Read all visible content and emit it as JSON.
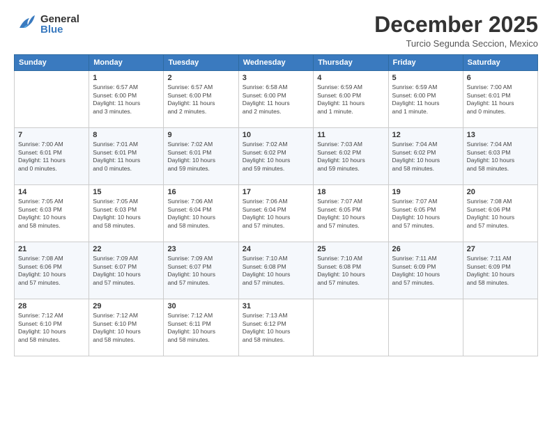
{
  "header": {
    "logo_general": "General",
    "logo_blue": "Blue",
    "month_title": "December 2025",
    "location": "Turcio Segunda Seccion, Mexico"
  },
  "calendar": {
    "days_of_week": [
      "Sunday",
      "Monday",
      "Tuesday",
      "Wednesday",
      "Thursday",
      "Friday",
      "Saturday"
    ],
    "weeks": [
      [
        {
          "day": "",
          "info": ""
        },
        {
          "day": "1",
          "info": "Sunrise: 6:57 AM\nSunset: 6:00 PM\nDaylight: 11 hours\nand 3 minutes."
        },
        {
          "day": "2",
          "info": "Sunrise: 6:57 AM\nSunset: 6:00 PM\nDaylight: 11 hours\nand 2 minutes."
        },
        {
          "day": "3",
          "info": "Sunrise: 6:58 AM\nSunset: 6:00 PM\nDaylight: 11 hours\nand 2 minutes."
        },
        {
          "day": "4",
          "info": "Sunrise: 6:59 AM\nSunset: 6:00 PM\nDaylight: 11 hours\nand 1 minute."
        },
        {
          "day": "5",
          "info": "Sunrise: 6:59 AM\nSunset: 6:00 PM\nDaylight: 11 hours\nand 1 minute."
        },
        {
          "day": "6",
          "info": "Sunrise: 7:00 AM\nSunset: 6:01 PM\nDaylight: 11 hours\nand 0 minutes."
        }
      ],
      [
        {
          "day": "7",
          "info": "Sunrise: 7:00 AM\nSunset: 6:01 PM\nDaylight: 11 hours\nand 0 minutes."
        },
        {
          "day": "8",
          "info": "Sunrise: 7:01 AM\nSunset: 6:01 PM\nDaylight: 11 hours\nand 0 minutes."
        },
        {
          "day": "9",
          "info": "Sunrise: 7:02 AM\nSunset: 6:01 PM\nDaylight: 10 hours\nand 59 minutes."
        },
        {
          "day": "10",
          "info": "Sunrise: 7:02 AM\nSunset: 6:02 PM\nDaylight: 10 hours\nand 59 minutes."
        },
        {
          "day": "11",
          "info": "Sunrise: 7:03 AM\nSunset: 6:02 PM\nDaylight: 10 hours\nand 59 minutes."
        },
        {
          "day": "12",
          "info": "Sunrise: 7:04 AM\nSunset: 6:02 PM\nDaylight: 10 hours\nand 58 minutes."
        },
        {
          "day": "13",
          "info": "Sunrise: 7:04 AM\nSunset: 6:03 PM\nDaylight: 10 hours\nand 58 minutes."
        }
      ],
      [
        {
          "day": "14",
          "info": "Sunrise: 7:05 AM\nSunset: 6:03 PM\nDaylight: 10 hours\nand 58 minutes."
        },
        {
          "day": "15",
          "info": "Sunrise: 7:05 AM\nSunset: 6:03 PM\nDaylight: 10 hours\nand 58 minutes."
        },
        {
          "day": "16",
          "info": "Sunrise: 7:06 AM\nSunset: 6:04 PM\nDaylight: 10 hours\nand 58 minutes."
        },
        {
          "day": "17",
          "info": "Sunrise: 7:06 AM\nSunset: 6:04 PM\nDaylight: 10 hours\nand 57 minutes."
        },
        {
          "day": "18",
          "info": "Sunrise: 7:07 AM\nSunset: 6:05 PM\nDaylight: 10 hours\nand 57 minutes."
        },
        {
          "day": "19",
          "info": "Sunrise: 7:07 AM\nSunset: 6:05 PM\nDaylight: 10 hours\nand 57 minutes."
        },
        {
          "day": "20",
          "info": "Sunrise: 7:08 AM\nSunset: 6:06 PM\nDaylight: 10 hours\nand 57 minutes."
        }
      ],
      [
        {
          "day": "21",
          "info": "Sunrise: 7:08 AM\nSunset: 6:06 PM\nDaylight: 10 hours\nand 57 minutes."
        },
        {
          "day": "22",
          "info": "Sunrise: 7:09 AM\nSunset: 6:07 PM\nDaylight: 10 hours\nand 57 minutes."
        },
        {
          "day": "23",
          "info": "Sunrise: 7:09 AM\nSunset: 6:07 PM\nDaylight: 10 hours\nand 57 minutes."
        },
        {
          "day": "24",
          "info": "Sunrise: 7:10 AM\nSunset: 6:08 PM\nDaylight: 10 hours\nand 57 minutes."
        },
        {
          "day": "25",
          "info": "Sunrise: 7:10 AM\nSunset: 6:08 PM\nDaylight: 10 hours\nand 57 minutes."
        },
        {
          "day": "26",
          "info": "Sunrise: 7:11 AM\nSunset: 6:09 PM\nDaylight: 10 hours\nand 57 minutes."
        },
        {
          "day": "27",
          "info": "Sunrise: 7:11 AM\nSunset: 6:09 PM\nDaylight: 10 hours\nand 58 minutes."
        }
      ],
      [
        {
          "day": "28",
          "info": "Sunrise: 7:12 AM\nSunset: 6:10 PM\nDaylight: 10 hours\nand 58 minutes."
        },
        {
          "day": "29",
          "info": "Sunrise: 7:12 AM\nSunset: 6:10 PM\nDaylight: 10 hours\nand 58 minutes."
        },
        {
          "day": "30",
          "info": "Sunrise: 7:12 AM\nSunset: 6:11 PM\nDaylight: 10 hours\nand 58 minutes."
        },
        {
          "day": "31",
          "info": "Sunrise: 7:13 AM\nSunset: 6:12 PM\nDaylight: 10 hours\nand 58 minutes."
        },
        {
          "day": "",
          "info": ""
        },
        {
          "day": "",
          "info": ""
        },
        {
          "day": "",
          "info": ""
        }
      ]
    ]
  }
}
